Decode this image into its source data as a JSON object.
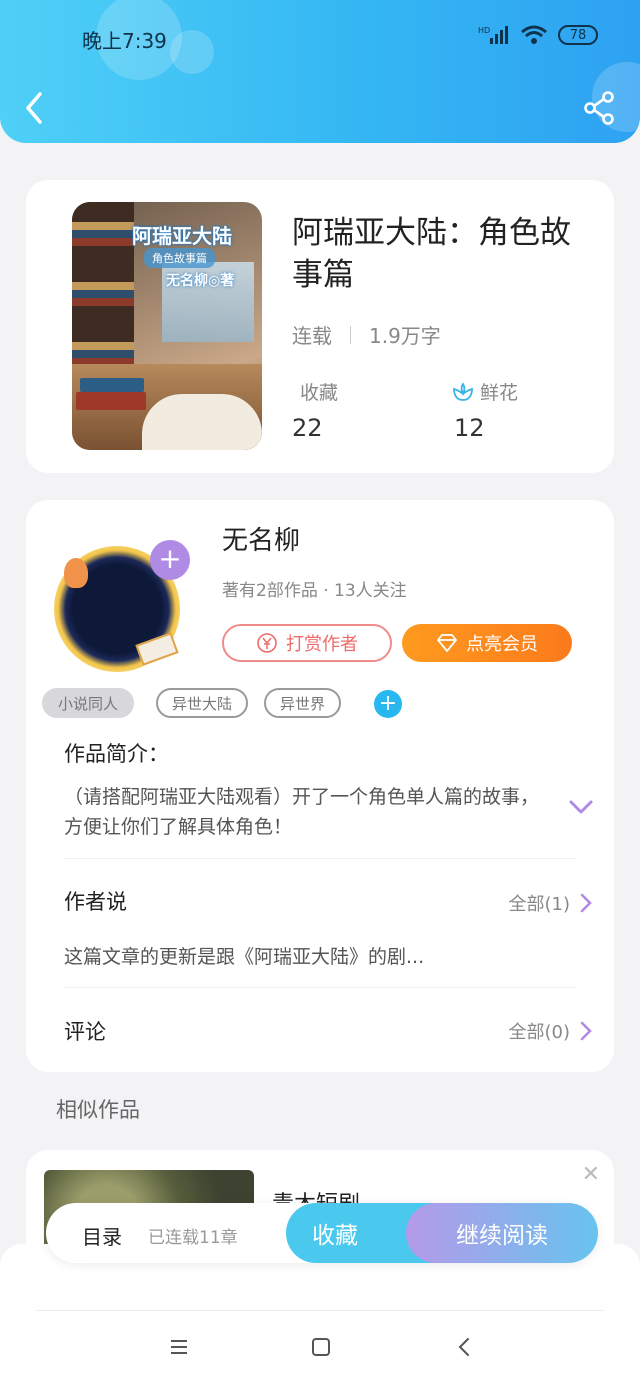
{
  "status_bar": {
    "time": "晚上7:39",
    "battery": "78",
    "network": "HD"
  },
  "book": {
    "cover": {
      "title": "阿瑞亚大陆",
      "subtitle": "角色故事篇",
      "author": "无名柳◎著"
    },
    "title": "阿瑞亚大陆：角色故事篇",
    "status": "连载",
    "word_count": "1.9万字",
    "favorites_label": "收藏",
    "favorites_count": "22",
    "flowers_label": "鲜花",
    "flowers_count": "12"
  },
  "author": {
    "name": "无名柳",
    "meta": "著有2部作品 · 13人关注",
    "tip_button": "打赏作者",
    "vip_button": "点亮会员"
  },
  "tags": [
    "小说同人",
    "异世大陆",
    "异世界"
  ],
  "intro": {
    "label": "作品简介：",
    "text": "（请搭配阿瑞亚大陆观看）开了一个角色单人篇的故事，方便让你们了解具体角色！"
  },
  "author_says": {
    "label": "作者说",
    "more": "全部(1)",
    "preview": "这篇文章的更新是跟《阿瑞亚大陆》的剧..."
  },
  "comments": {
    "label": "评论",
    "more": "全部(0)"
  },
  "similar": {
    "label": "相似作品",
    "first_title": "青木短剧"
  },
  "action_bar": {
    "toc": "目录",
    "chapters": "已连载11章",
    "favorite": "收藏",
    "continue": "继续阅读"
  },
  "colors": {
    "header": "#35b7f3",
    "accent_purple": "#b08be6",
    "tip": "#ee6b6b",
    "vip": "#fb7a1c"
  }
}
